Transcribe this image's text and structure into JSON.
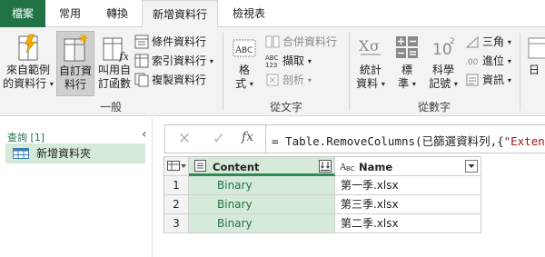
{
  "tabs": {
    "file": "檔案",
    "home": "常用",
    "transform": "轉換",
    "add_column": "新增資料行",
    "view": "檢視表"
  },
  "ribbon": {
    "example_col": {
      "line1": "來自範例",
      "line2": "的資料行"
    },
    "custom_col": {
      "line1": "自訂資",
      "line2": "料行"
    },
    "invoke_fn": {
      "line1": "叫用自",
      "line2": "訂函數"
    },
    "conditional_col": "條件資料行",
    "index_col": "索引資料行",
    "duplicate_col": "複製資料行",
    "group_general": "一般",
    "format": {
      "line1": "格",
      "line2": "式"
    },
    "merge_cols": "合併資料行",
    "extract": "擷取",
    "parse": "剖析",
    "group_text": "從文字",
    "statistics": {
      "line1": "統計",
      "line2": "資料"
    },
    "standard": {
      "line1": "標",
      "line2": "準"
    },
    "scientific": {
      "line1": "科學",
      "line2": "記號"
    },
    "trig": "三角",
    "rounding": "進位",
    "information": "資訊",
    "group_number": "從數字",
    "date": "日"
  },
  "queries": {
    "header": "查詢 [1]",
    "item": "新增資料夾"
  },
  "formula": {
    "prefix": "= Table.RemoveColumns(已篩選資料列,{",
    "string": "\"Extension"
  },
  "grid": {
    "columns": [
      {
        "name": "Content"
      },
      {
        "name": "Name"
      }
    ],
    "rows": [
      {
        "num": "1",
        "content": "Binary",
        "name": "第一季.xlsx"
      },
      {
        "num": "2",
        "content": "Binary",
        "name": "第三季.xlsx"
      },
      {
        "num": "3",
        "content": "Binary",
        "name": "第二季.xlsx"
      }
    ]
  },
  "colors": {
    "accent": "#217346",
    "selected_column": "#d6ead9"
  }
}
